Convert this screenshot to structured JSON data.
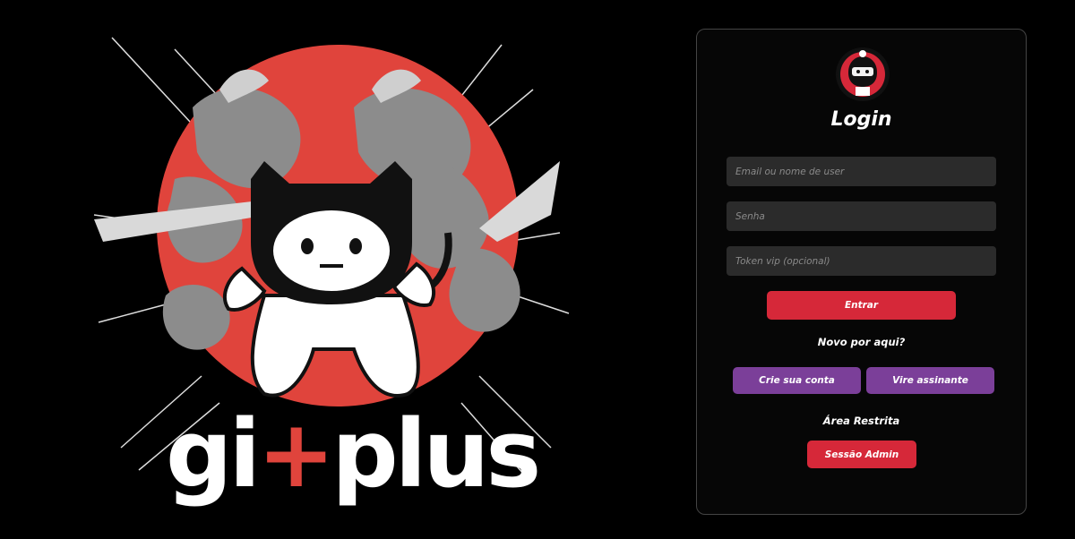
{
  "brand": {
    "prefix": "gi",
    "plus_glyph": "+",
    "suffix": "plus"
  },
  "login": {
    "title": "Login",
    "email_placeholder": "Email ou nome de user",
    "password_placeholder": "Senha",
    "token_placeholder": "Token vip (opcional)",
    "submit_label": "Entrar",
    "new_here_text": "Novo por aqui?",
    "create_account_label": "Crie sua conta",
    "subscribe_label": "Vire assinante",
    "restricted_area_text": "Área Restrita",
    "admin_session_label": "Sessão Admin"
  },
  "colors": {
    "accent_red": "#d62839",
    "accent_purple": "#7b3f99",
    "sun_red": "#e0443c",
    "field_bg": "#2b2b2b",
    "card_border": "#444444"
  },
  "icons": {
    "avatar": "ninja-cat-icon"
  }
}
